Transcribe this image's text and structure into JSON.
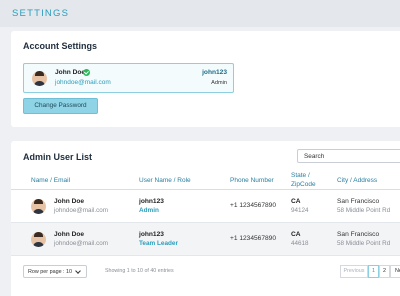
{
  "header": {
    "title": "SETTINGS"
  },
  "account": {
    "title": "Account Settings",
    "name": "John Doe",
    "email": "johndoe@mail.com",
    "username": "john123",
    "role": "Admin",
    "change_password": "Change Password"
  },
  "users": {
    "title": "Admin User List",
    "search_placeholder": "Search",
    "columns": [
      "Name / Email",
      "User Name / Role",
      "Phone Number",
      "State / ZipCode",
      "City / Address"
    ],
    "rows": [
      {
        "name": "John Doe",
        "email": "johndoe@mail.com",
        "username": "john123",
        "role": "Admin",
        "phone": "+1 1234567890",
        "state": "CA",
        "zip": "94124",
        "city": "San Francisco",
        "address": "58 Middle Point Rd"
      },
      {
        "name": "John Doe",
        "email": "johndoe@mail.com",
        "username": "john123",
        "role": "Team Leader",
        "phone": "+1 1234567890",
        "state": "CA",
        "zip": "44618",
        "city": "San Francisco",
        "address": "58 Middle Point Rd"
      }
    ],
    "rows_per_page": "Row per page : 10",
    "entries_info": "Showing 1 to 10 of 40 entries",
    "pagination": {
      "previous": "Previous",
      "page1": "1",
      "page2": "2",
      "next": "Next"
    }
  },
  "colors": {
    "accent": "#2a9dbc",
    "button": "#8fd3e6",
    "background": "#eef0f4"
  },
  "icons": [
    "verified-icon",
    "chevron-down-icon",
    "avatar"
  ]
}
